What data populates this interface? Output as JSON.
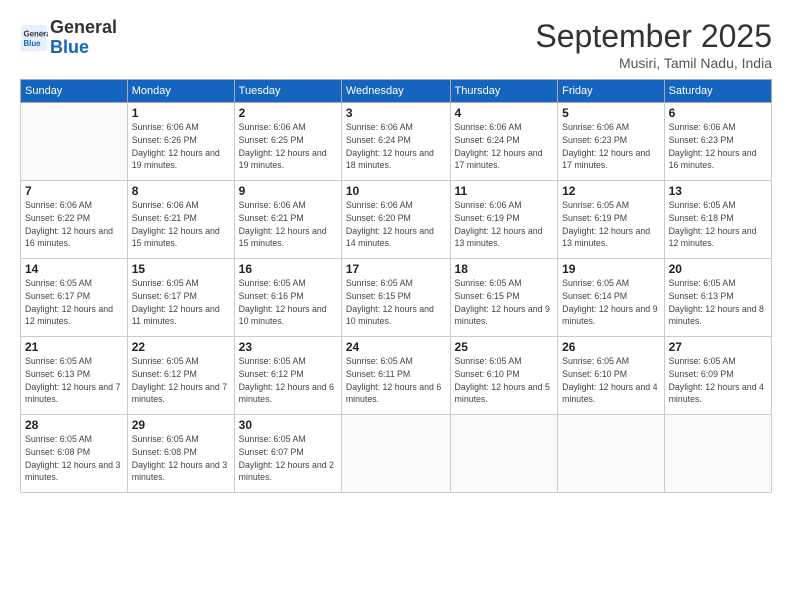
{
  "header": {
    "logo": "GeneralBlue",
    "month": "September 2025",
    "location": "Musiri, Tamil Nadu, India"
  },
  "days_of_week": [
    "Sunday",
    "Monday",
    "Tuesday",
    "Wednesday",
    "Thursday",
    "Friday",
    "Saturday"
  ],
  "weeks": [
    [
      {
        "day": "",
        "sunrise": "",
        "sunset": "",
        "daylight": ""
      },
      {
        "day": "1",
        "sunrise": "6:06 AM",
        "sunset": "6:26 PM",
        "daylight": "12 hours and 19 minutes."
      },
      {
        "day": "2",
        "sunrise": "6:06 AM",
        "sunset": "6:25 PM",
        "daylight": "12 hours and 19 minutes."
      },
      {
        "day": "3",
        "sunrise": "6:06 AM",
        "sunset": "6:24 PM",
        "daylight": "12 hours and 18 minutes."
      },
      {
        "day": "4",
        "sunrise": "6:06 AM",
        "sunset": "6:24 PM",
        "daylight": "12 hours and 17 minutes."
      },
      {
        "day": "5",
        "sunrise": "6:06 AM",
        "sunset": "6:23 PM",
        "daylight": "12 hours and 17 minutes."
      },
      {
        "day": "6",
        "sunrise": "6:06 AM",
        "sunset": "6:23 PM",
        "daylight": "12 hours and 16 minutes."
      }
    ],
    [
      {
        "day": "7",
        "sunrise": "6:06 AM",
        "sunset": "6:22 PM",
        "daylight": "12 hours and 16 minutes."
      },
      {
        "day": "8",
        "sunrise": "6:06 AM",
        "sunset": "6:21 PM",
        "daylight": "12 hours and 15 minutes."
      },
      {
        "day": "9",
        "sunrise": "6:06 AM",
        "sunset": "6:21 PM",
        "daylight": "12 hours and 15 minutes."
      },
      {
        "day": "10",
        "sunrise": "6:06 AM",
        "sunset": "6:20 PM",
        "daylight": "12 hours and 14 minutes."
      },
      {
        "day": "11",
        "sunrise": "6:06 AM",
        "sunset": "6:19 PM",
        "daylight": "12 hours and 13 minutes."
      },
      {
        "day": "12",
        "sunrise": "6:05 AM",
        "sunset": "6:19 PM",
        "daylight": "12 hours and 13 minutes."
      },
      {
        "day": "13",
        "sunrise": "6:05 AM",
        "sunset": "6:18 PM",
        "daylight": "12 hours and 12 minutes."
      }
    ],
    [
      {
        "day": "14",
        "sunrise": "6:05 AM",
        "sunset": "6:17 PM",
        "daylight": "12 hours and 12 minutes."
      },
      {
        "day": "15",
        "sunrise": "6:05 AM",
        "sunset": "6:17 PM",
        "daylight": "12 hours and 11 minutes."
      },
      {
        "day": "16",
        "sunrise": "6:05 AM",
        "sunset": "6:16 PM",
        "daylight": "12 hours and 10 minutes."
      },
      {
        "day": "17",
        "sunrise": "6:05 AM",
        "sunset": "6:15 PM",
        "daylight": "12 hours and 10 minutes."
      },
      {
        "day": "18",
        "sunrise": "6:05 AM",
        "sunset": "6:15 PM",
        "daylight": "12 hours and 9 minutes."
      },
      {
        "day": "19",
        "sunrise": "6:05 AM",
        "sunset": "6:14 PM",
        "daylight": "12 hours and 9 minutes."
      },
      {
        "day": "20",
        "sunrise": "6:05 AM",
        "sunset": "6:13 PM",
        "daylight": "12 hours and 8 minutes."
      }
    ],
    [
      {
        "day": "21",
        "sunrise": "6:05 AM",
        "sunset": "6:13 PM",
        "daylight": "12 hours and 7 minutes."
      },
      {
        "day": "22",
        "sunrise": "6:05 AM",
        "sunset": "6:12 PM",
        "daylight": "12 hours and 7 minutes."
      },
      {
        "day": "23",
        "sunrise": "6:05 AM",
        "sunset": "6:12 PM",
        "daylight": "12 hours and 6 minutes."
      },
      {
        "day": "24",
        "sunrise": "6:05 AM",
        "sunset": "6:11 PM",
        "daylight": "12 hours and 6 minutes."
      },
      {
        "day": "25",
        "sunrise": "6:05 AM",
        "sunset": "6:10 PM",
        "daylight": "12 hours and 5 minutes."
      },
      {
        "day": "26",
        "sunrise": "6:05 AM",
        "sunset": "6:10 PM",
        "daylight": "12 hours and 4 minutes."
      },
      {
        "day": "27",
        "sunrise": "6:05 AM",
        "sunset": "6:09 PM",
        "daylight": "12 hours and 4 minutes."
      }
    ],
    [
      {
        "day": "28",
        "sunrise": "6:05 AM",
        "sunset": "6:08 PM",
        "daylight": "12 hours and 3 minutes."
      },
      {
        "day": "29",
        "sunrise": "6:05 AM",
        "sunset": "6:08 PM",
        "daylight": "12 hours and 3 minutes."
      },
      {
        "day": "30",
        "sunrise": "6:05 AM",
        "sunset": "6:07 PM",
        "daylight": "12 hours and 2 minutes."
      },
      {
        "day": "",
        "sunrise": "",
        "sunset": "",
        "daylight": ""
      },
      {
        "day": "",
        "sunrise": "",
        "sunset": "",
        "daylight": ""
      },
      {
        "day": "",
        "sunrise": "",
        "sunset": "",
        "daylight": ""
      },
      {
        "day": "",
        "sunrise": "",
        "sunset": "",
        "daylight": ""
      }
    ]
  ]
}
